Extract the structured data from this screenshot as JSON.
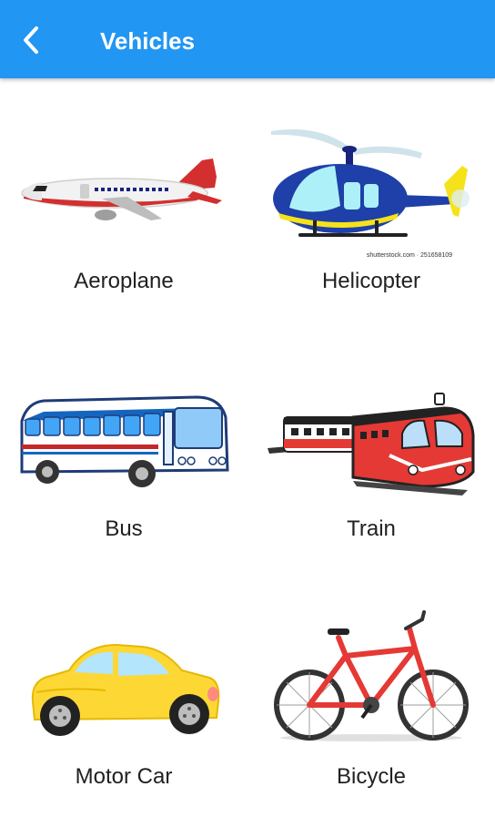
{
  "appbar": {
    "title": "Vehicles",
    "back_icon": "arrow-back-icon",
    "color": "#2196f3"
  },
  "vehicles": [
    {
      "label": "Aeroplane",
      "icon": "aeroplane-icon"
    },
    {
      "label": "Helicopter",
      "icon": "helicopter-icon",
      "credit": "shutterstock.com · 251658109"
    },
    {
      "label": "Bus",
      "icon": "bus-icon"
    },
    {
      "label": "Train",
      "icon": "train-icon"
    },
    {
      "label": "Motor Car",
      "icon": "car-icon"
    },
    {
      "label": "Bicycle",
      "icon": "bicycle-icon"
    }
  ]
}
